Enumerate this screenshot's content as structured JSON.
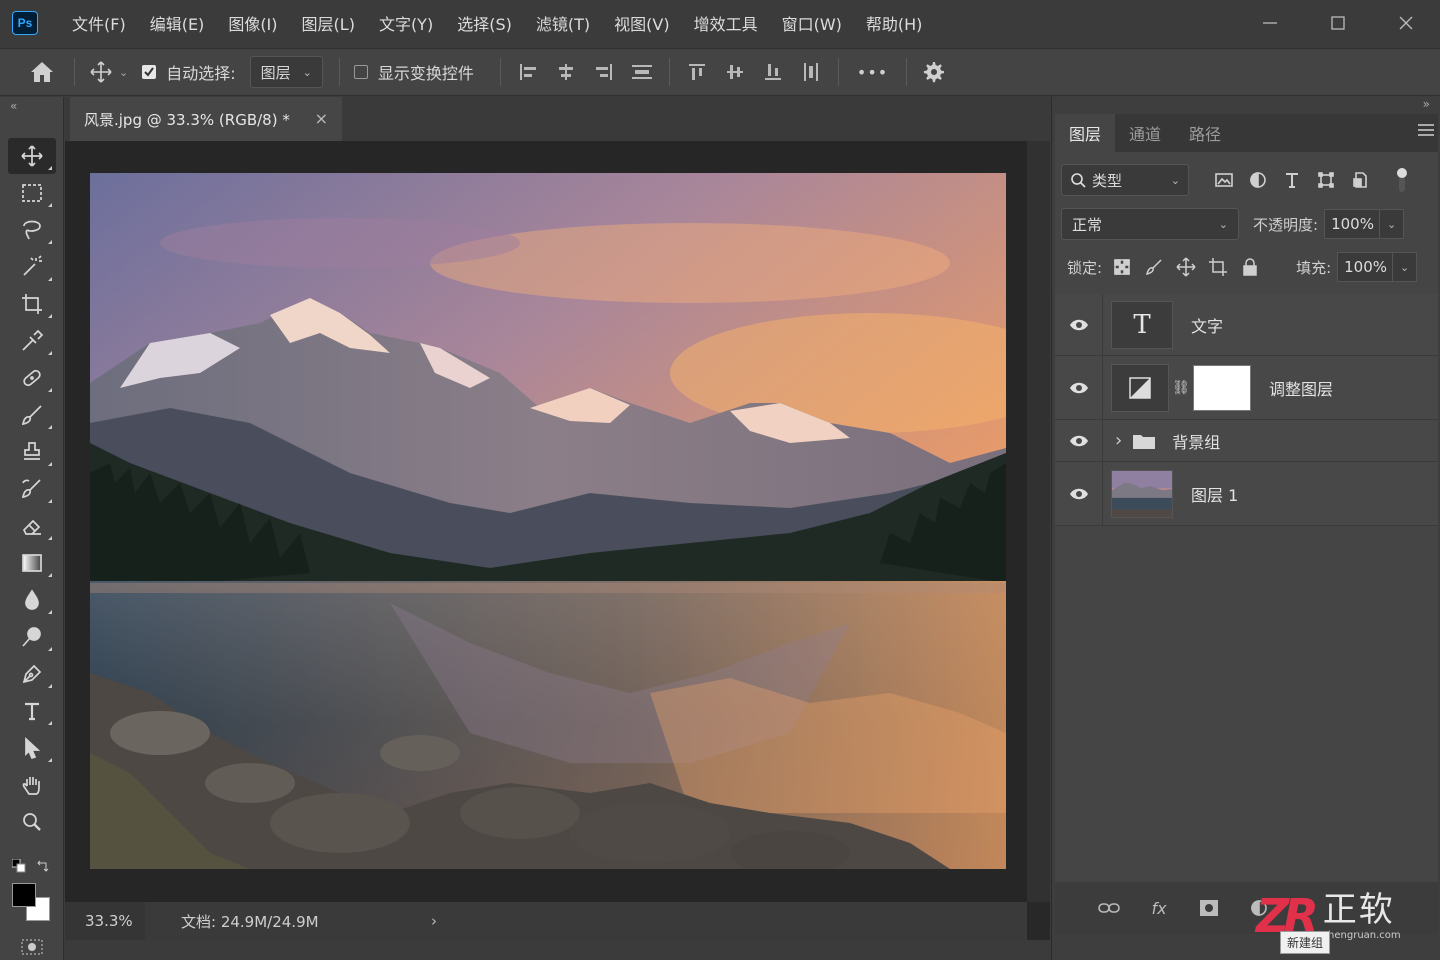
{
  "app": {
    "logo": "Ps"
  },
  "menu": [
    "文件(F)",
    "编辑(E)",
    "图像(I)",
    "图层(L)",
    "文字(Y)",
    "选择(S)",
    "滤镜(T)",
    "视图(V)",
    "增效工具",
    "窗口(W)",
    "帮助(H)"
  ],
  "options": {
    "auto_select_label": "自动选择:",
    "auto_select_checked": true,
    "auto_select_target": "图层",
    "show_transform_label": "显示变换控件",
    "show_transform_checked": false,
    "more": "•••"
  },
  "toolbar": {
    "collapse": "«",
    "tools": [
      "move-tool",
      "marquee-tool",
      "lasso-tool",
      "magic-wand-tool",
      "crop-tool",
      "eyedropper-tool",
      "healing-brush-tool",
      "brush-tool",
      "clone-stamp-tool",
      "history-brush-tool",
      "eraser-tool",
      "gradient-tool",
      "blur-tool",
      "dodge-tool",
      "pen-tool",
      "type-tool",
      "path-selection-tool",
      "hand-tool",
      "zoom-tool"
    ],
    "foreground_color": "#000000",
    "background_color": "#ffffff"
  },
  "document": {
    "tab_title": "风景.jpg @ 33.3% (RGB/8) *",
    "close": "×",
    "zoom": "33.3%",
    "doc_info": "文档: 24.9M/24.9M",
    "status_arrow": "›"
  },
  "panel": {
    "collapse": "»",
    "tabs": [
      "图层",
      "通道",
      "路径"
    ],
    "active_tab": 0,
    "filter_kind": "类型",
    "blend_mode": "正常",
    "opacity_label": "不透明度:",
    "opacity": "100%",
    "lock_label": "锁定:",
    "fill_label": "填充:",
    "fill": "100%",
    "layers": [
      {
        "name": "文字",
        "kind": "text",
        "visible": true,
        "thumb": "T"
      },
      {
        "name": "调整图层",
        "kind": "adjustment",
        "visible": true
      },
      {
        "name": "背景组",
        "kind": "group",
        "visible": true,
        "expander": "›"
      },
      {
        "name": "图层 1",
        "kind": "pixel",
        "visible": true
      }
    ],
    "footer_tooltip": "新建组"
  },
  "watermark": {
    "logo": "ZR",
    "name": "正软",
    "url": "zhengruan.com"
  }
}
